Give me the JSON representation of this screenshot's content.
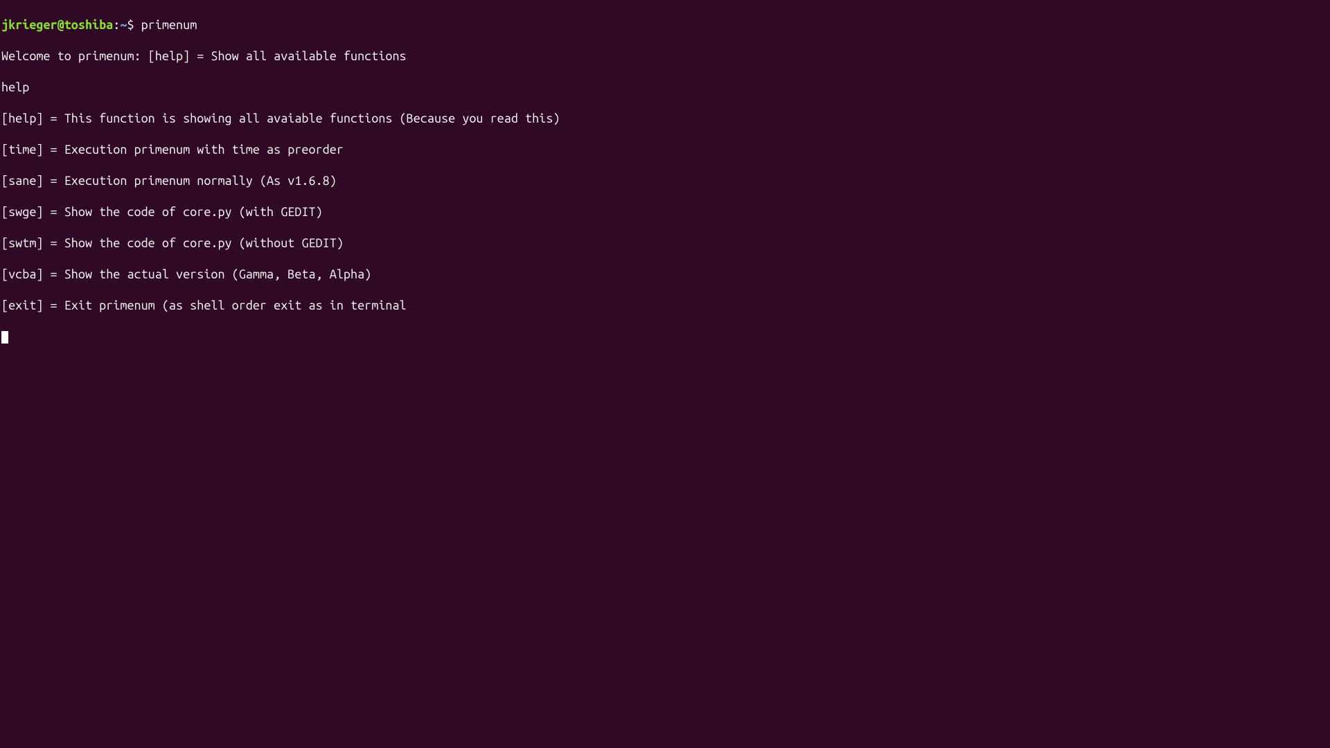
{
  "prompt": {
    "user_host": "jkrieger@toshiba",
    "colon": ":",
    "path": "~",
    "dollar": "$ ",
    "command": "primenum"
  },
  "output": {
    "welcome": "Welcome to primenum: [help] = Show all available functions",
    "typed_help": "help",
    "help_line": "[help] = This function is showing all avaiable functions (Because you read this)",
    "time_line": "[time] = Execution primenum with time as preorder",
    "sane_line": "[sane] = Execution primenum normally (As v1.6.8)",
    "swge_line": "[swge] = Show the code of core.py (with GEDIT)",
    "swtm_line": "[swtm] = Show the code of core.py (without GEDIT)",
    "vcba_line": "[vcba] = Show the actual version (Gamma, Beta, Alpha)",
    "exit_line": "[exit] = Exit primenum (as shell order exit as in terminal"
  }
}
